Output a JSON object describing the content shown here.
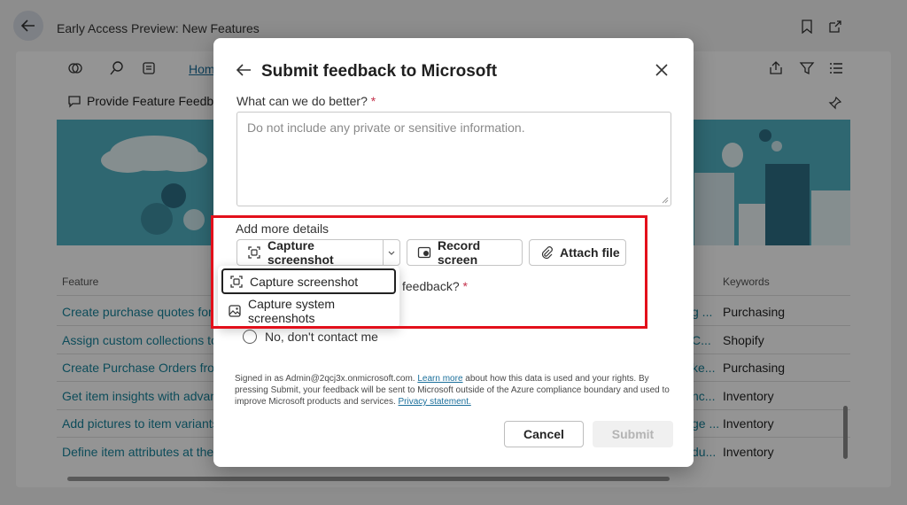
{
  "background": {
    "page_title": "Early Access Preview: New Features",
    "home_link": "Home",
    "feedback_label": "Provide Feature Feedback",
    "columns": {
      "feature": "Feature",
      "keywords": "Keywords"
    },
    "rows": [
      {
        "feature": "Create purchase quotes for co",
        "mid": "g ...",
        "keyword": "Purchasing"
      },
      {
        "feature": "Assign custom collections to i",
        "mid": "C...",
        "keyword": "Shopify"
      },
      {
        "feature": "Create Purchase Orders from",
        "mid": "ke...",
        "keyword": "Purchasing"
      },
      {
        "feature": "Get item insights with advanc",
        "mid": "nc...",
        "keyword": "Inventory"
      },
      {
        "feature": "Add pictures to item variants",
        "mid": "ge ...",
        "keyword": "Inventory"
      },
      {
        "feature": "Define item attributes at the i",
        "mid": "du...",
        "keyword": "Inventory"
      }
    ]
  },
  "dialog": {
    "title": "Submit feedback to Microsoft",
    "question": "What can we do better?",
    "required_mark": "*",
    "textarea_placeholder": "Do not include any private or sensitive information.",
    "more_details_label": "Add more details",
    "capture_button": "Capture screenshot",
    "record_button": "Record screen",
    "attach_button": "Attach file",
    "contact_question": "feedback?",
    "contact_no": "No, don't contact me",
    "legal": {
      "prefix": "Signed in as Admin@2qcj3x.onmicrosoft.com.",
      "learn_more": "Learn more",
      "middle": "about how this data is used and your rights. By pressing Submit, your feedback will be sent to Microsoft outside of the Azure compliance boundary and used to improve Microsoft products and services.",
      "privacy": "Privacy statement."
    },
    "cancel": "Cancel",
    "submit": "Submit"
  },
  "dropdown_menu": {
    "items": [
      {
        "label": "Capture screenshot",
        "icon": "capture-icon",
        "focused": true
      },
      {
        "label": "Capture system screenshots",
        "icon": "image-icon",
        "focused": false
      }
    ]
  },
  "colors": {
    "accent_link": "#17839b",
    "highlight_box": "#e3101b",
    "banner": "#51b2c3"
  }
}
